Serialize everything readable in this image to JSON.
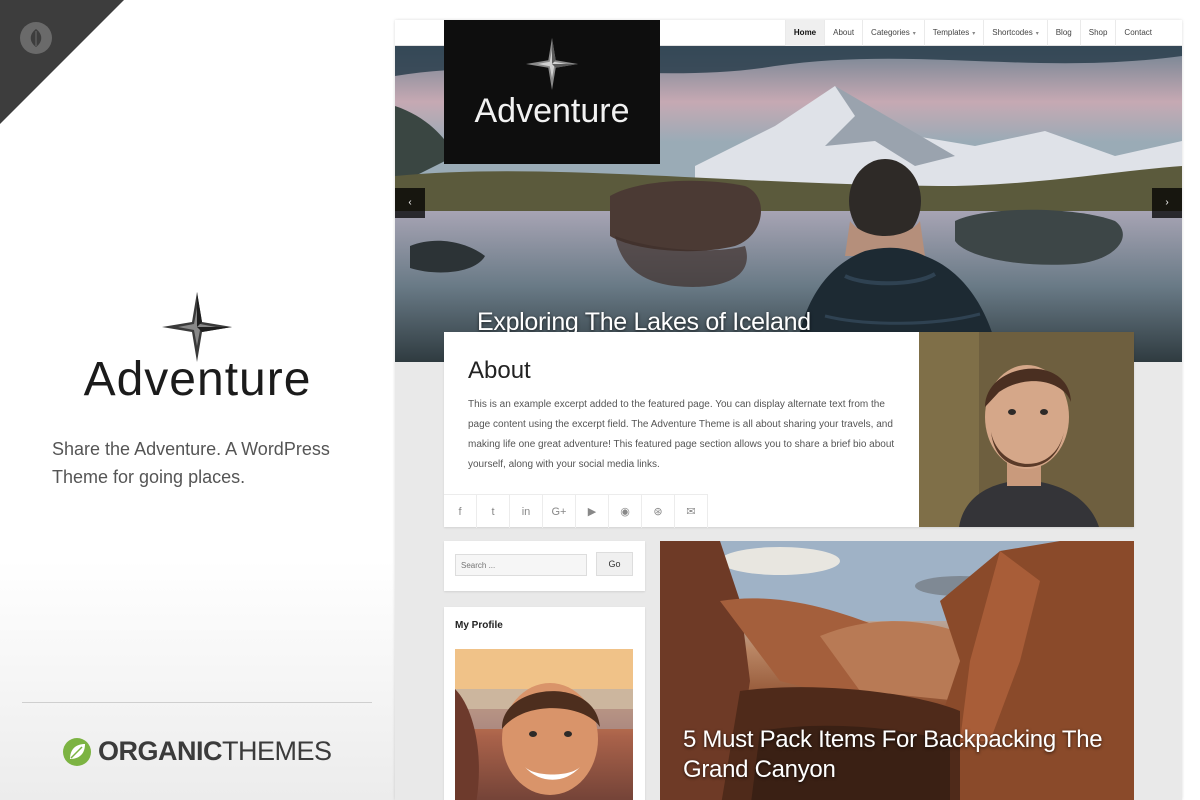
{
  "promo": {
    "title": "Adventure",
    "tagline": "Share the Adventure. A WordPress Theme for going places.",
    "brand_bold": "ORGANIC",
    "brand_light": "THEMES"
  },
  "site": {
    "logo_title": "Adventure",
    "nav": [
      {
        "label": "Home",
        "active": true
      },
      {
        "label": "About"
      },
      {
        "label": "Categories",
        "dropdown": true
      },
      {
        "label": "Templates",
        "dropdown": true
      },
      {
        "label": "Shortcodes",
        "dropdown": true
      },
      {
        "label": "Blog"
      },
      {
        "label": "Shop"
      },
      {
        "label": "Contact"
      }
    ],
    "hero": {
      "caption": "Exploring The Lakes of Iceland",
      "prev_icon": "‹",
      "next_icon": "›"
    },
    "about": {
      "title": "About",
      "text": "This is an example excerpt added to the featured page. You can display alternate text from the page content using the excerpt field. The Adventure Theme is all about sharing your travels, and making life one great adventure! This featured page section allows you to share a brief bio about yourself, along with your social media links.",
      "social": [
        {
          "name": "facebook-icon",
          "glyph": "f"
        },
        {
          "name": "twitter-icon",
          "glyph": "t"
        },
        {
          "name": "linkedin-icon",
          "glyph": "in"
        },
        {
          "name": "google-plus-icon",
          "glyph": "G+"
        },
        {
          "name": "youtube-icon",
          "glyph": "▶"
        },
        {
          "name": "github-icon",
          "glyph": "◉"
        },
        {
          "name": "dribbble-icon",
          "glyph": "⊛"
        },
        {
          "name": "email-icon",
          "glyph": "✉"
        }
      ]
    },
    "search": {
      "placeholder": "Search ...",
      "button": "Go"
    },
    "profile": {
      "title": "My Profile"
    },
    "feature_post": {
      "title": "5 Must Pack Items For Backpacking The Grand Canyon"
    }
  },
  "colors": {
    "logo_bg": "#0e0e0e",
    "corner": "#3d3d3d",
    "brand_leaf": "#7cb342"
  }
}
